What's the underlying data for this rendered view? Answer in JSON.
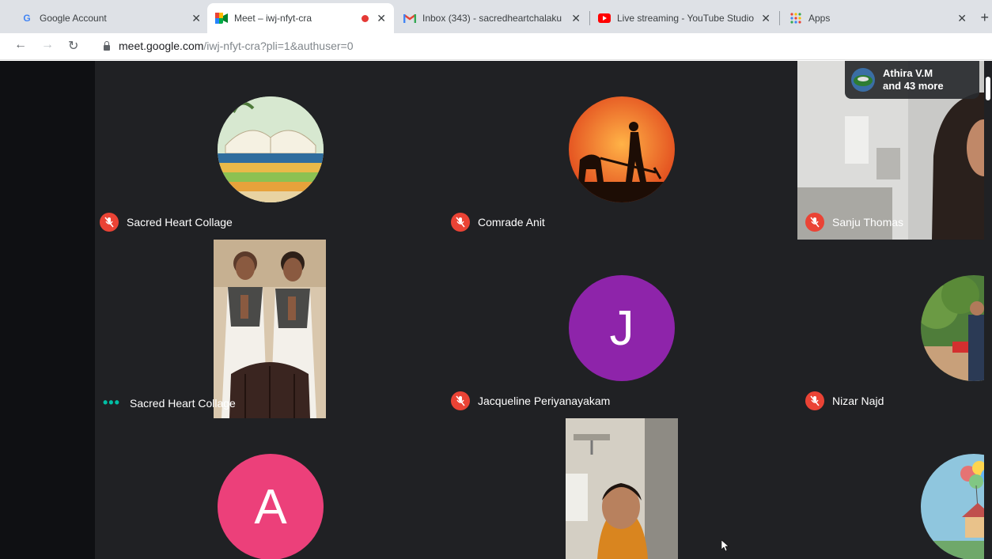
{
  "browser": {
    "tabs": [
      {
        "title": "Google Account",
        "icon": "google-g-icon"
      },
      {
        "title": "Meet – iwj-nfyt-cra",
        "icon": "meet-icon"
      },
      {
        "title": "Inbox (343) - sacredheartchalaku",
        "icon": "gmail-icon"
      },
      {
        "title": "Live streaming - YouTube Studio",
        "icon": "youtube-icon"
      },
      {
        "title": "Apps",
        "icon": "apps-grid-icon"
      }
    ],
    "address": {
      "host": "meet.google.com",
      "path": "/iwj-nfyt-cra?pli=1&authuser=0"
    }
  },
  "meet": {
    "participants_badge": {
      "name": "Athira V.M",
      "more": "and 43 more"
    },
    "tiles": [
      {
        "name": "Sacred Heart Collage",
        "status": "muted"
      },
      {
        "name": "Comrade Anit",
        "status": "muted"
      },
      {
        "name": "Sanju Thomas",
        "status": "muted"
      },
      {
        "name": "Sacred Heart Collage",
        "status": "speaking"
      },
      {
        "name": "Jacqueline Periyanayakam",
        "status": "muted",
        "initial": "J",
        "color": "#8e24aa"
      },
      {
        "name": "Nizar Najd",
        "status": "muted"
      },
      {
        "name": "",
        "initial": "A",
        "color": "#ec407a"
      }
    ]
  },
  "colors": {
    "meet_bg": "#202124",
    "mic_off": "#ea4335",
    "speaking_dots": "#00bfa5"
  }
}
